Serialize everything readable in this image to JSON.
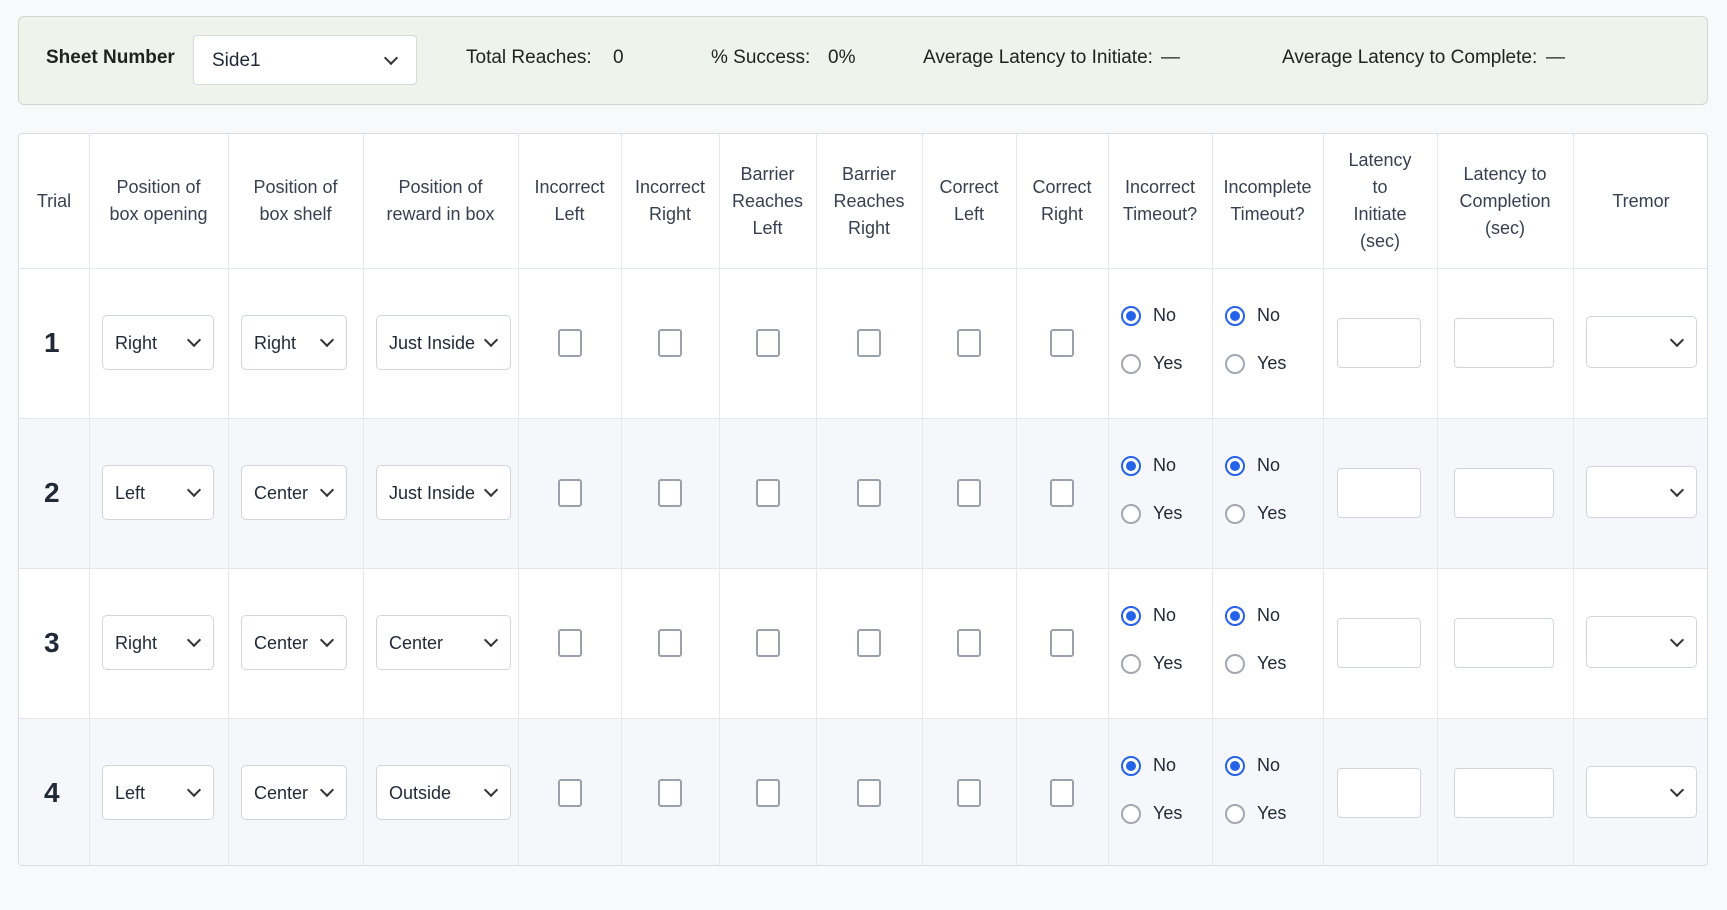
{
  "summary": {
    "sheet_label": "Sheet Number",
    "sheet_value": "Side1",
    "total_reaches_label": "Total Reaches:",
    "total_reaches_value": "0",
    "success_label": "% Success:",
    "success_value": "0%",
    "avg_init_label": "Average Latency to Initiate:",
    "avg_init_value": "—",
    "avg_complete_label": "Average Latency to Complete:",
    "avg_complete_value": "—"
  },
  "headers": [
    "Trial",
    "Position of\nbox opening",
    "Position of\nbox shelf",
    "Position of\nreward in box",
    "Incorrect\nLeft",
    "Incorrect\nRight",
    "Barrier\nReaches\nLeft",
    "Barrier\nReaches\nRight",
    "Correct\nLeft",
    "Correct\nRight",
    "Incorrect\nTimeout?",
    "Incomplete\nTimeout?",
    "Latency\nto\nInitiate\n(sec)",
    "Latency to\nCompletion\n(sec)",
    "Tremor"
  ],
  "radio_labels": {
    "no": "No",
    "yes": "Yes"
  },
  "rows": [
    {
      "trial": "1",
      "opening": "Right",
      "shelf": "Right",
      "reward": "Just Inside",
      "incorrect_timeout": "No",
      "incomplete_timeout": "No",
      "latency_initiate": "",
      "latency_completion": "",
      "tremor": ""
    },
    {
      "trial": "2",
      "opening": "Left",
      "shelf": "Center",
      "reward": "Just Inside",
      "incorrect_timeout": "No",
      "incomplete_timeout": "No",
      "latency_initiate": "",
      "latency_completion": "",
      "tremor": ""
    },
    {
      "trial": "3",
      "opening": "Right",
      "shelf": "Center",
      "reward": "Center",
      "incorrect_timeout": "No",
      "incomplete_timeout": "No",
      "latency_initiate": "",
      "latency_completion": "",
      "tremor": ""
    },
    {
      "trial": "4",
      "opening": "Left",
      "shelf": "Center",
      "reward": "Outside",
      "incorrect_timeout": "No",
      "incomplete_timeout": "No",
      "latency_initiate": "",
      "latency_completion": "",
      "tremor": ""
    }
  ],
  "colors": {
    "accent": "#2563eb",
    "summary_bg": "#eef3ec",
    "alt_row_bg": "#f5f7fa"
  }
}
